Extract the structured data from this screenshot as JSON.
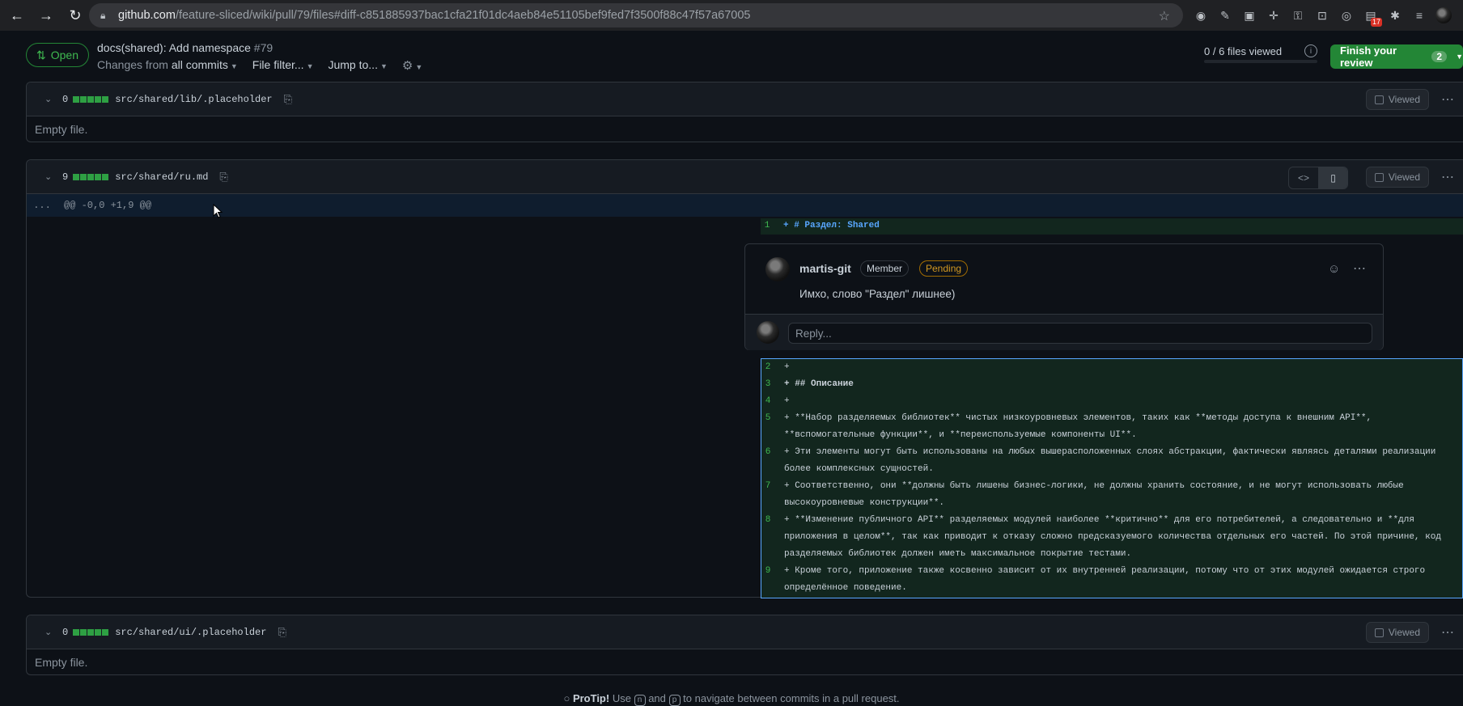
{
  "browser": {
    "url_domain": "github.com",
    "url_path": "/feature-sliced/wiki/pull/79/files#diff-c851885937bac1cfa21f01dc4aeb84e51105bef9fed7f3500f88c47f57a67005",
    "ext_badge": "17"
  },
  "pr": {
    "status": "Open",
    "title": "docs(shared): Add namespace",
    "number": "#79",
    "changes_prefix": "Changes from",
    "changes_value": "all commits",
    "file_filter": "File filter...",
    "jump_to": "Jump to...",
    "files_viewed": "0 / 6 files viewed",
    "finish_label": "Finish your review",
    "finish_count": "2"
  },
  "files": [
    {
      "count": "0",
      "name": "src/shared/lib/.placeholder",
      "viewed": "Viewed",
      "body": "Empty file."
    },
    {
      "count": "9",
      "name": "src/shared/ru.md",
      "viewed": "Viewed",
      "hunk_dots": "...",
      "hunk": "@@ -0,0 +1,9 @@"
    },
    {
      "count": "0",
      "name": "src/shared/ui/.placeholder",
      "viewed": "Viewed",
      "body": "Empty file."
    }
  ],
  "diff": {
    "line1_num": "1",
    "line1_text": "+ # Раздел: Shared",
    "lines": [
      {
        "num": "2",
        "text": "+"
      },
      {
        "num": "3",
        "text": "+ ## Описание"
      },
      {
        "num": "4",
        "text": "+"
      },
      {
        "num": "5",
        "text": "+ **Набор разделяемых библиотек** чистых низкоуровневых элементов, таких как **методы доступа к внешним API**, **вспомогательные функции**, и **переиспользуемые компоненты UI**."
      },
      {
        "num": "6",
        "text": "+ Эти элементы могут быть использованы на любых вышерасположенных слоях абстракции, фактически являясь деталями реализации более комплексных сущностей."
      },
      {
        "num": "7",
        "text": "+ Соответственно, они **должны быть лишены бизнес-логики, не должны хранить состояние, и не могут использовать любые высокоуровневые конструкции**."
      },
      {
        "num": "8",
        "text": "+ **Изменение публичного API** разделяемых модулей наиболее **критично** для его потребителей, а следовательно и **для приложения в целом**, так как приводит к отказу сложно предсказуемого количества отдельных его частей. По этой причине, код разделяемых библиотек должен иметь максимальное покрытие тестами."
      },
      {
        "num": "9",
        "text": "+ Кроме того, приложение также косвенно зависит от их внутренней реализации, потому что от этих модулей ожидается строго определённое поведение."
      }
    ]
  },
  "comment": {
    "author": "martis-git",
    "role": "Member",
    "state": "Pending",
    "body": "Имхо, слово \"Раздел\" лишнее)",
    "reply_placeholder": "Reply..."
  },
  "protip": {
    "label": "ProTip!",
    "t1": "Use",
    "k1": "n",
    "t2": "and",
    "k2": "p",
    "t3": "to navigate between commits in a pull request."
  }
}
